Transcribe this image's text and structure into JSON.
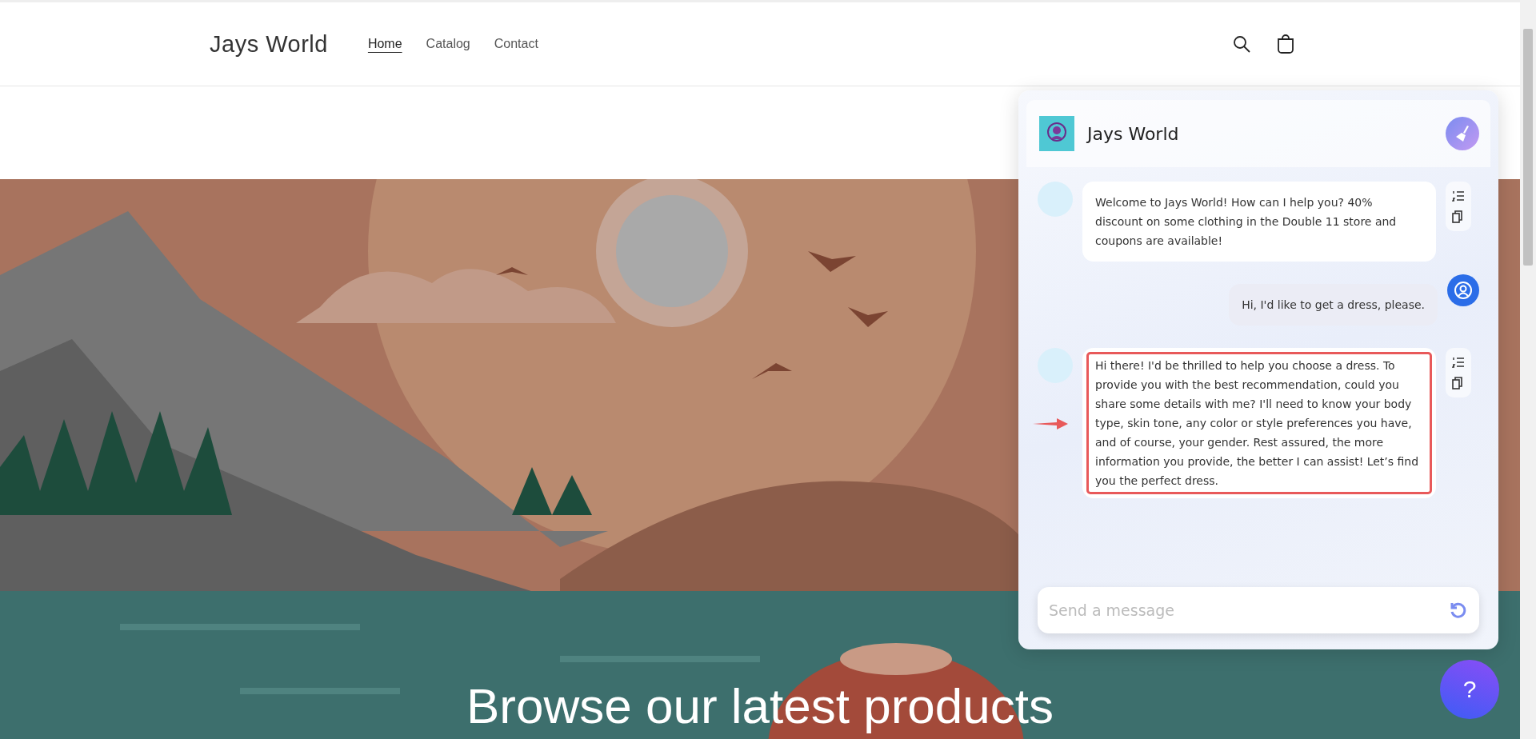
{
  "site_header": {
    "brand": "Jays World",
    "nav": [
      {
        "label": "Home",
        "selected": true
      },
      {
        "label": "Catalog",
        "selected": false
      },
      {
        "label": "Contact",
        "selected": false
      }
    ]
  },
  "hero": {
    "headline": "Browse our latest products"
  },
  "chat": {
    "title": "Jays World",
    "messages": [
      {
        "kind": "bot",
        "text": "Welcome to Jays World! How can I help you? 40% discount on some clothing in the Double 11 store and coupons are available!"
      },
      {
        "kind": "user",
        "text": "Hi, I'd like to get a dress, please."
      },
      {
        "kind": "highlighted",
        "text": "Hi there! I'd be thrilled to help you choose a dress. To provide you with the best recommendation, could you share some details with me? I'll need to know your body type, skin tone, any color or style preferences you have, and of course, your gender. Rest assured, the more information you provide, the better I can assist! Let’s find you the perfect dress."
      }
    ],
    "input": {
      "placeholder": "Send a message"
    }
  },
  "help_button": {
    "label": "?"
  }
}
